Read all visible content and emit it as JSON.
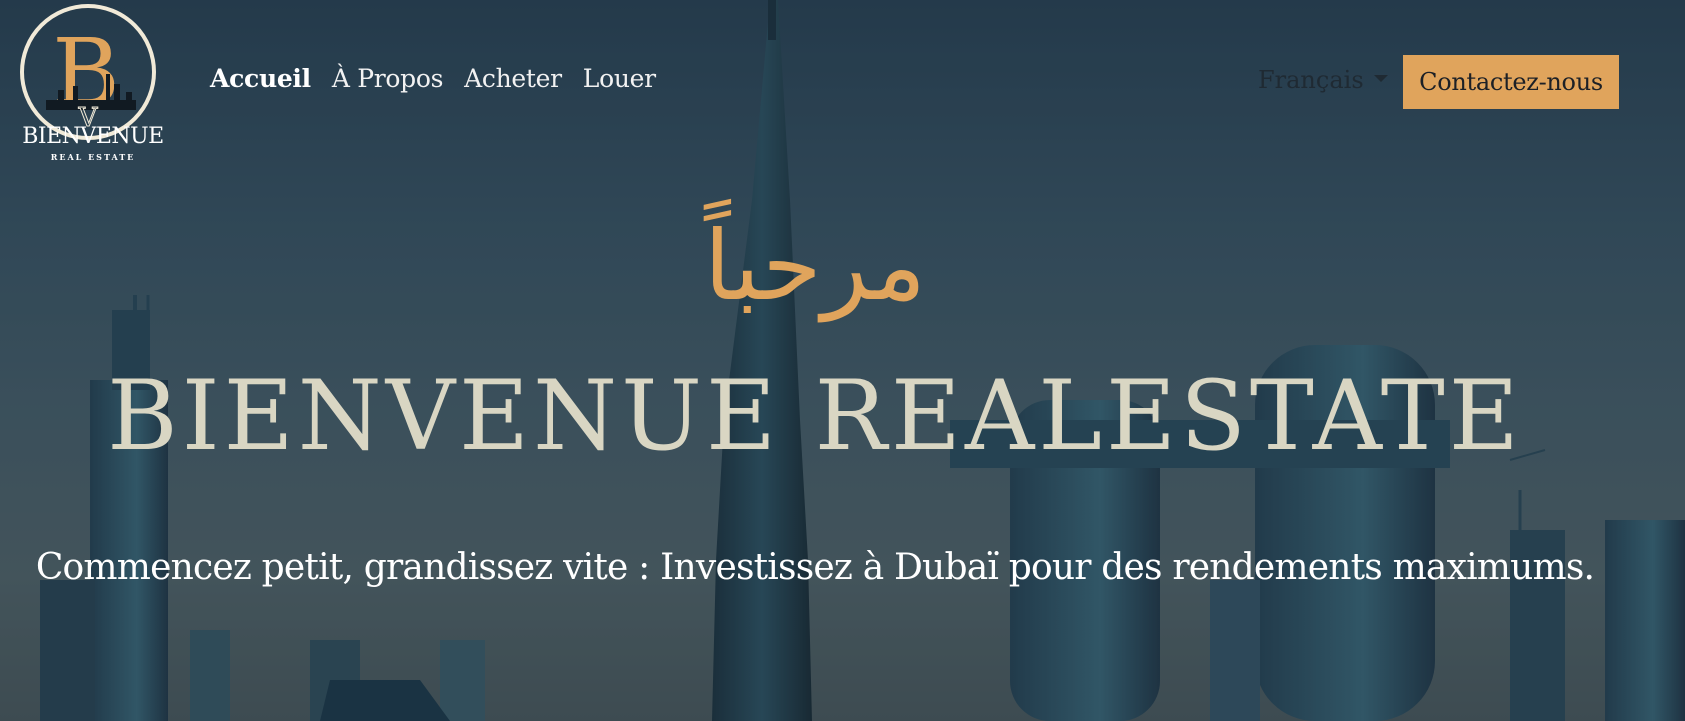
{
  "brand": {
    "logo_letter": "B",
    "name": "BIENVENUE",
    "subtitle": "REAL ESTATE"
  },
  "nav": {
    "items": [
      {
        "label": "Accueil",
        "active": true
      },
      {
        "label": "À Propos",
        "active": false
      },
      {
        "label": "Acheter",
        "active": false
      },
      {
        "label": "Louer",
        "active": false
      }
    ]
  },
  "language": {
    "selected": "Français"
  },
  "contact_button": "Contactez-nous",
  "hero": {
    "arabic_greeting": "مرحباً",
    "headline": "BIENVENUE REALESTATE",
    "tagline": "Commencez petit, grandissez vite : Investissez à Dubaï pour des rendements maximums."
  },
  "colors": {
    "accent": "#e0a45c",
    "headline": "#d9d6c3",
    "text": "#ffffff"
  }
}
